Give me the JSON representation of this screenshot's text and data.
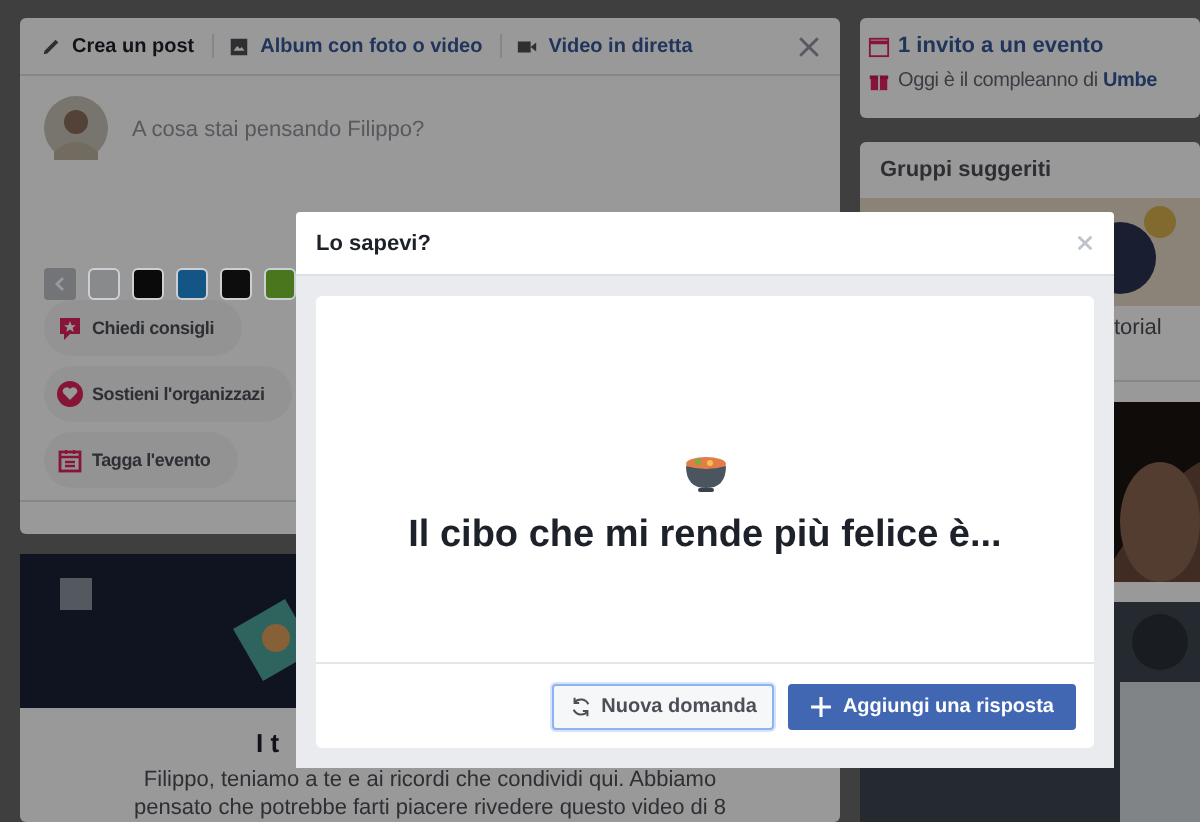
{
  "composer": {
    "tabs": [
      {
        "label": "Crea un post",
        "selected": true,
        "kind": "post"
      },
      {
        "label": "Album con foto o video",
        "selected": false,
        "kind": "album"
      },
      {
        "label": "Video in diretta",
        "selected": false,
        "kind": "live"
      }
    ],
    "placeholder": "A cosa stai pensando Filippo?",
    "swatches": [
      {
        "color": "#898a8c"
      },
      {
        "color": "#0a0a0a"
      },
      {
        "color": "#135686"
      },
      {
        "color": "#0d0d0d"
      },
      {
        "color": "#4a761e"
      }
    ],
    "actions": [
      {
        "label": "Chiedi consigli",
        "kind": "ask"
      },
      {
        "label": "Sostieni l'organizzazi",
        "kind": "support"
      },
      {
        "label": "Tagga l'evento",
        "kind": "event"
      }
    ]
  },
  "memory_card": {
    "title": "I t",
    "text": "Filippo, teniamo a te e ai ricordi che condividi qui. Abbiamo pensato che potrebbe farti piacere rivedere questo video di 8"
  },
  "events_card": {
    "invite": "1 invito a un evento",
    "birthday": "Oggi è il compleanno di **Umbe**"
  },
  "groups_card": {
    "title": "Gruppi suggeriti",
    "items": [
      {
        "name": "torial"
      }
    ]
  },
  "dialog": {
    "title": "Lo sapevi?",
    "question": "Il cibo che mi rende più felice è...",
    "buttons": [
      {
        "label": "Nuova domanda",
        "kind": "secondary"
      },
      {
        "label": "Aggiungi una risposta",
        "kind": "primary"
      }
    ]
  }
}
